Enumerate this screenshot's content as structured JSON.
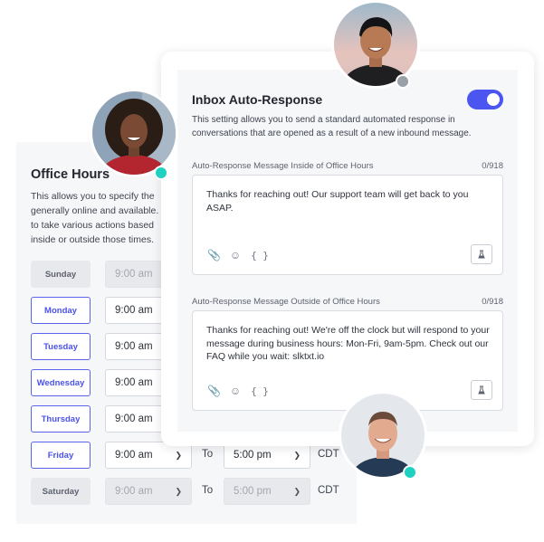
{
  "office_hours": {
    "title": "Office Hours",
    "description_lines": [
      "This allows you to specify the",
      "generally online and available.",
      "to take various actions based",
      "inside or outside those times."
    ],
    "to_label": "To",
    "rows": [
      {
        "day": "Sunday",
        "enabled": false,
        "start": "9:00 am",
        "end": "",
        "tz": ""
      },
      {
        "day": "Monday",
        "enabled": true,
        "start": "9:00 am",
        "end": "",
        "tz": ""
      },
      {
        "day": "Tuesday",
        "enabled": true,
        "start": "9:00 am",
        "end": "",
        "tz": ""
      },
      {
        "day": "Wednesday",
        "enabled": true,
        "start": "9:00 am",
        "end": "",
        "tz": ""
      },
      {
        "day": "Thursday",
        "enabled": true,
        "start": "9:00 am",
        "end": "",
        "tz": ""
      },
      {
        "day": "Friday",
        "enabled": true,
        "start": "9:00 am",
        "end": "5:00 pm",
        "tz": "CDT"
      },
      {
        "day": "Saturday",
        "enabled": false,
        "start": "9:00 am",
        "end": "5:00 pm",
        "tz": "CDT"
      }
    ]
  },
  "auto_response": {
    "title": "Inbox Auto-Response",
    "enabled": true,
    "description": "This setting allows you to send a standard automated response in conversations that are opened as a result of a new inbound message.",
    "inside": {
      "label": "Auto-Response Message Inside of Office Hours",
      "count": "0/918",
      "message": "Thanks for reaching out! Our support team will get back to you ASAP."
    },
    "outside": {
      "label": "Auto-Response Message Outside of Office Hours",
      "count": "0/918",
      "message": "Thanks for reaching out! We're off the clock but will respond to your message during business hours: Mon-Fri, 9am-5pm. Check out our FAQ while you wait: slktxt.io"
    },
    "tool_icons": [
      "paperclip-icon",
      "emoji-icon",
      "variables-icon",
      "test-flask-icon"
    ]
  },
  "colors": {
    "accent": "#4b55f0",
    "online": "#1fd1c1",
    "offline": "#9aa0a8"
  }
}
